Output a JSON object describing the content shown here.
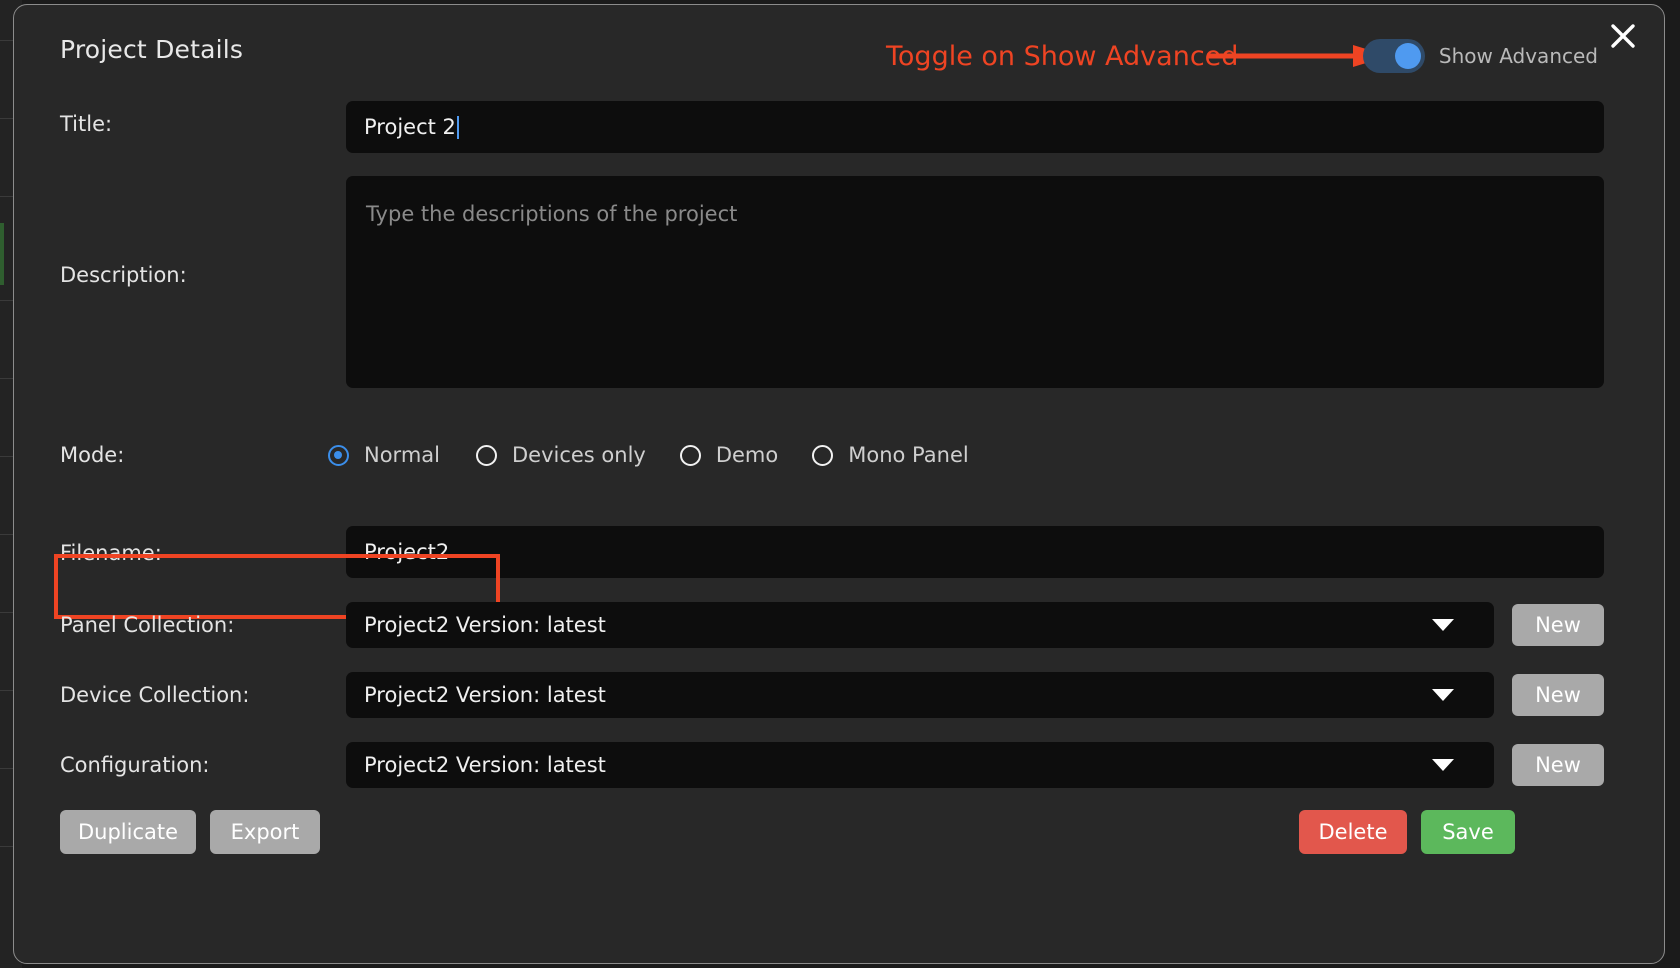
{
  "dialog": {
    "title": "Project Details",
    "close_icon": "close-icon"
  },
  "header": {
    "toggle_label": "Show Advanced",
    "toggle_state": "on"
  },
  "annotations": {
    "toggle_note": "Toggle on Show Advanced",
    "arrow_color": "#ef4423",
    "box_color": "#ef4423",
    "text_color": "#ef4423"
  },
  "fields": {
    "title": {
      "label": "Title:",
      "value": "Project 2",
      "placeholder": ""
    },
    "description": {
      "label": "Description:",
      "value": "",
      "placeholder": "Type the descriptions of the project"
    },
    "mode": {
      "label": "Mode:",
      "options": [
        {
          "label": "Normal",
          "selected": true
        },
        {
          "label": "Devices only",
          "selected": false
        },
        {
          "label": "Demo",
          "selected": false
        },
        {
          "label": "Mono Panel",
          "selected": false
        }
      ]
    },
    "filename": {
      "label": "Filename:",
      "value": "Project2"
    },
    "panel_collection": {
      "label": "Panel Collection:",
      "value": "Project2 Version: latest",
      "new_label": "New"
    },
    "device_collection": {
      "label": "Device Collection:",
      "value": "Project2 Version: latest",
      "new_label": "New"
    },
    "configuration": {
      "label": "Configuration:",
      "value": "Project2 Version: latest",
      "new_label": "New"
    }
  },
  "actions": {
    "duplicate": "Duplicate",
    "export": "Export",
    "delete": "Delete",
    "save": "Save"
  },
  "colors": {
    "dialog_bg": "#282828",
    "input_bg": "#0d0d0d",
    "accent_blue": "#4f9af0",
    "annotation_red": "#ef4423",
    "delete_red": "#e2574c",
    "save_green": "#5cb85c",
    "button_grey": "#a9a9a9"
  }
}
